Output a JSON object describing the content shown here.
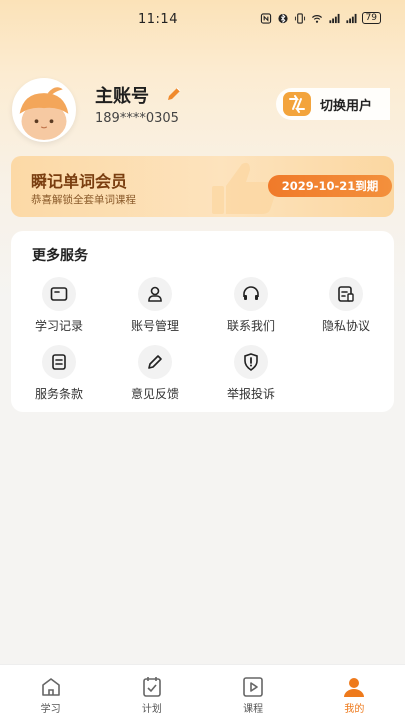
{
  "status_bar": {
    "time": "11:14",
    "battery": "79"
  },
  "profile": {
    "account_name": "主账号",
    "phone": "189****0305",
    "switch_user_label": "切换用户"
  },
  "vip": {
    "title": "瞬记单词会员",
    "subtitle": "恭喜解锁全套单词课程",
    "expire_label": "2029-10-21到期"
  },
  "services": {
    "title": "更多服务",
    "items": [
      {
        "label": "学习记录",
        "icon": "study-record-icon"
      },
      {
        "label": "账号管理",
        "icon": "account-icon"
      },
      {
        "label": "联系我们",
        "icon": "headset-icon"
      },
      {
        "label": "隐私协议",
        "icon": "privacy-doc-icon"
      },
      {
        "label": "服务条款",
        "icon": "terms-doc-icon"
      },
      {
        "label": "意见反馈",
        "icon": "pencil-icon"
      },
      {
        "label": "举报投诉",
        "icon": "shield-alert-icon"
      }
    ]
  },
  "tabs": [
    {
      "label": "学习",
      "icon": "home-icon",
      "active": false
    },
    {
      "label": "计划",
      "icon": "plan-icon",
      "active": false
    },
    {
      "label": "课程",
      "icon": "play-icon",
      "active": false
    },
    {
      "label": "我的",
      "icon": "user-icon",
      "active": true
    }
  ],
  "colors": {
    "accent": "#ee7a1c",
    "vip_text": "#7a3e10"
  }
}
